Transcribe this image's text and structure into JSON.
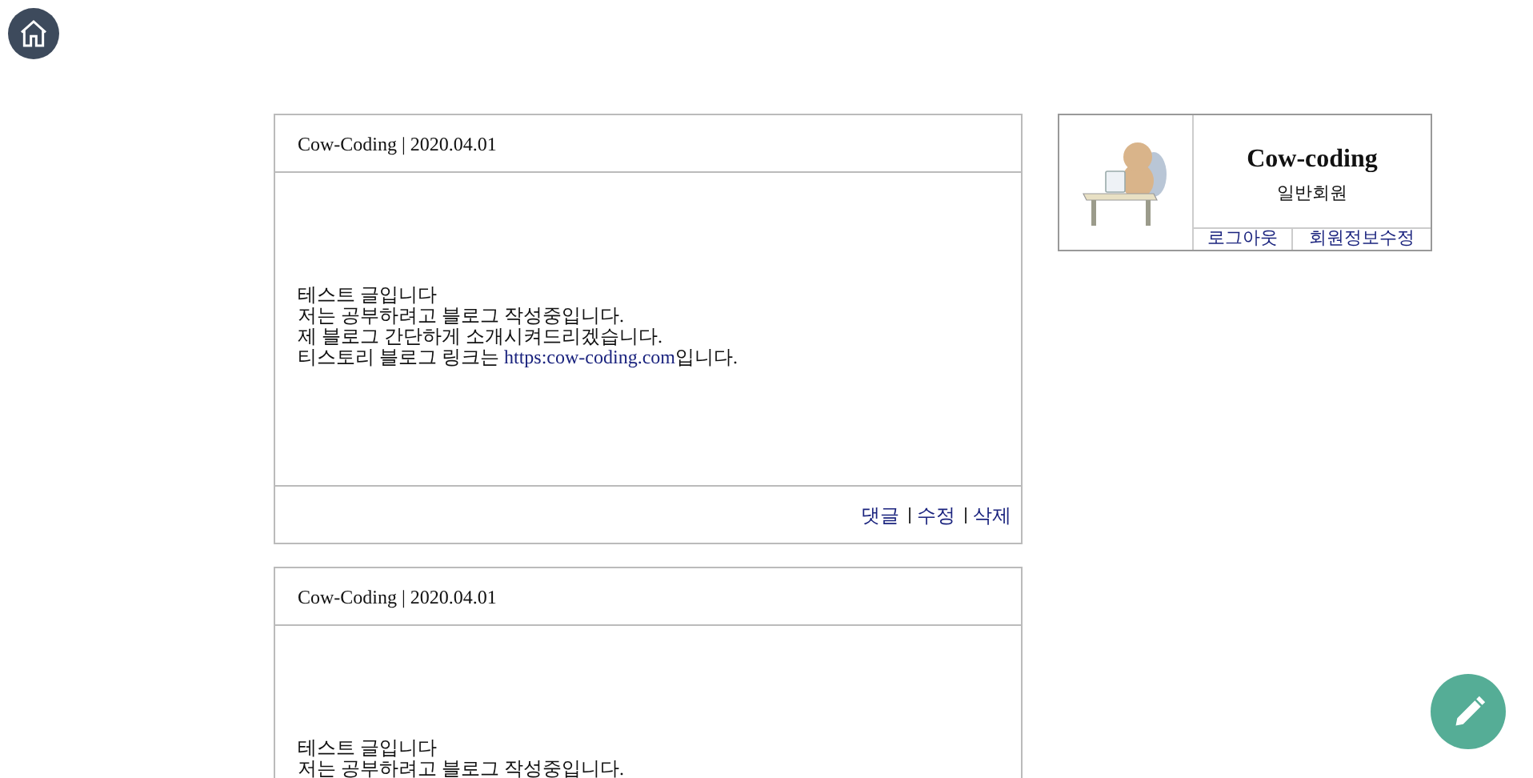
{
  "posts": [
    {
      "header": "Cow-Coding | 2020.04.01",
      "lines": [
        {
          "text": "테스트 글입니다"
        },
        {
          "text": "저는 공부하려고 블로그 작성중입니다."
        },
        {
          "text": "제 블로그 간단하게 소개시켜드리겠습니다."
        },
        {
          "text": "티스토리 블로그 링크는 ",
          "link": "https:cow-coding.com",
          "after": "입니다."
        }
      ],
      "actions": [
        "댓글",
        "수정",
        "삭제"
      ]
    },
    {
      "header": "Cow-Coding | 2020.04.01",
      "lines": [
        {
          "text": "테스트 글입니다"
        },
        {
          "text": "저는 공부하려고 블로그 작성중입니다."
        }
      ]
    }
  ],
  "profile": {
    "name": "Cow-coding",
    "role": "일반회원",
    "buttons": [
      "로그아웃",
      "회원정보수정"
    ]
  }
}
